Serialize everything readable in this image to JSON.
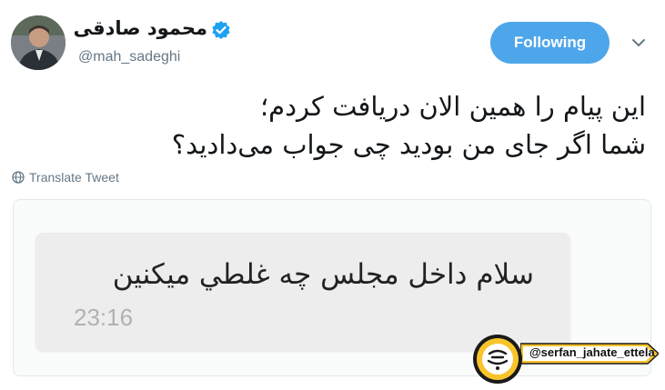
{
  "tweet": {
    "author": {
      "display_name": "محمود صادقی",
      "handle": "@mah_sadeghi",
      "avatar_icon": "user-avatar",
      "verified_icon": "verified-badge-icon"
    },
    "follow_button_label": "Following",
    "menu_icon": "chevron-down-icon",
    "text_lines": [
      "این پیام را همین الان دریافت کردم؛",
      "شما اگر جای من بودید چی جواب می‌دادید؟"
    ],
    "translate_label": "Translate Tweet",
    "translate_icon": "globe-icon"
  },
  "attachment": {
    "message_text": "سلام داخل مجلس چه غلطي ميكنين",
    "message_time": "23:16"
  },
  "watermark": {
    "handle": "@serfan_jahate_ettela"
  },
  "colors": {
    "follow_button": "#4ea6ea",
    "verified": "#1da1f2",
    "secondary_text": "#657786",
    "bubble": "#ededed",
    "watermark_yellow": "#f7c42a"
  }
}
